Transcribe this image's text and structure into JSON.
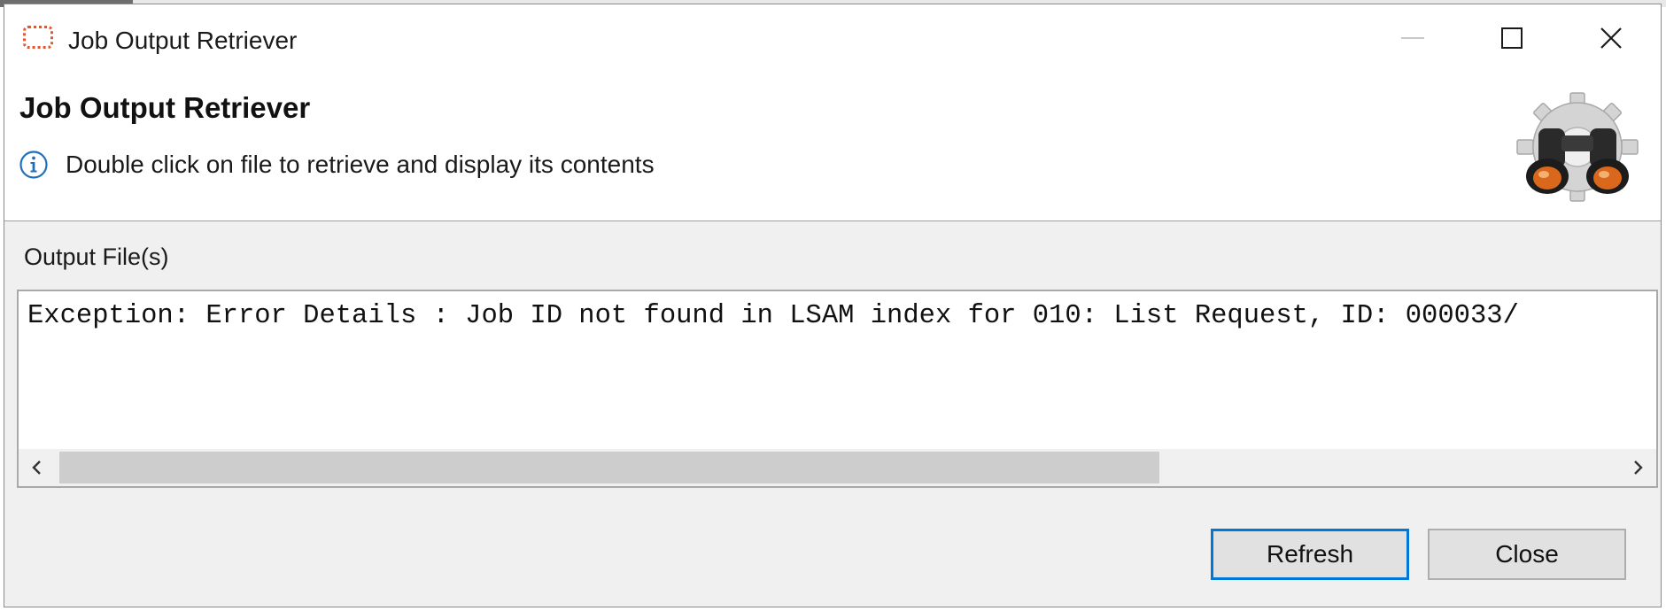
{
  "window": {
    "title": "Job Output Retriever"
  },
  "header": {
    "title": "Job Output Retriever",
    "info_message": "Double click on file to retrieve and display its contents",
    "graphic_icon": "binoculars-gear-icon"
  },
  "output": {
    "label": "Output File(s)",
    "content": "Exception: Error Details : Job ID not found in LSAM index for 010: List Request, ID: 000033/"
  },
  "buttons": {
    "refresh_label": "Refresh",
    "close_label": "Close"
  },
  "colors": {
    "focus_accent": "#0078d7",
    "app_icon": "#e5572b",
    "info_icon": "#1f6fbf"
  }
}
